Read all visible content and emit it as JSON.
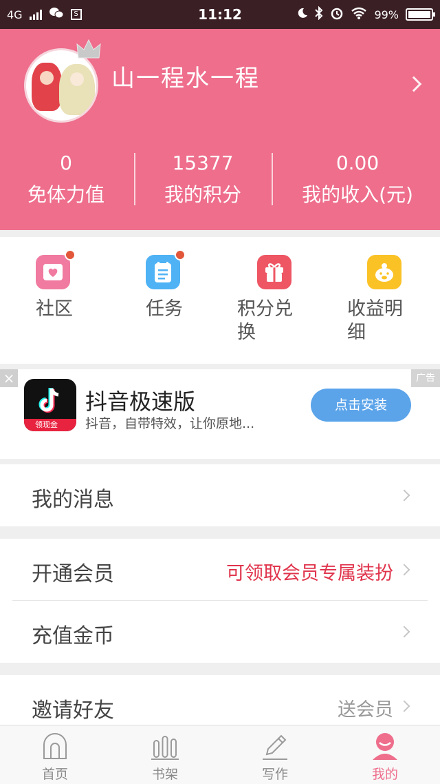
{
  "status_bar": {
    "network": "4G",
    "sim_icon_text": "S",
    "time": "11:12",
    "battery": "99%"
  },
  "profile": {
    "username": "山一程水一程",
    "stats": [
      {
        "value": "0",
        "label": "免体力值"
      },
      {
        "value": "15377",
        "label": "我的积分"
      },
      {
        "value": "0.00",
        "label": "我的收入(元)"
      }
    ]
  },
  "actions": [
    {
      "label": "社区",
      "icon": "community-icon",
      "color": "#f07aa0",
      "badge": true
    },
    {
      "label": "任务",
      "icon": "task-icon",
      "color": "#4fb2f5",
      "badge": true
    },
    {
      "label": "积分兑换",
      "icon": "gift-icon",
      "color": "#ee5664",
      "badge": false
    },
    {
      "label": "收益明细",
      "icon": "piggy-bank-icon",
      "color": "#fbc226",
      "badge": false
    }
  ],
  "ad": {
    "close": "×",
    "tag": "广告",
    "badge": "领现金",
    "title": "抖音极速版",
    "description": "抖音，自带特效，让你原地...",
    "button": "点击安装"
  },
  "menu": {
    "messages": {
      "label": "我的消息"
    },
    "vip": {
      "label": "开通会员",
      "extra": "可领取会员专属装扮",
      "extra_color": "#e0344c"
    },
    "coins": {
      "label": "充值金币"
    },
    "invite": {
      "label": "邀请好友",
      "extra": "送会员",
      "extra_color": "#999999"
    }
  },
  "tabbar": [
    {
      "label": "首页",
      "icon": "home-icon",
      "active": false
    },
    {
      "label": "书架",
      "icon": "bookshelf-icon",
      "active": false
    },
    {
      "label": "写作",
      "icon": "pen-icon",
      "active": false
    },
    {
      "label": "我的",
      "icon": "profile-icon",
      "active": true
    }
  ],
  "colors": {
    "accent": "#ee6e8c",
    "statusbar": "#3a1f25"
  }
}
